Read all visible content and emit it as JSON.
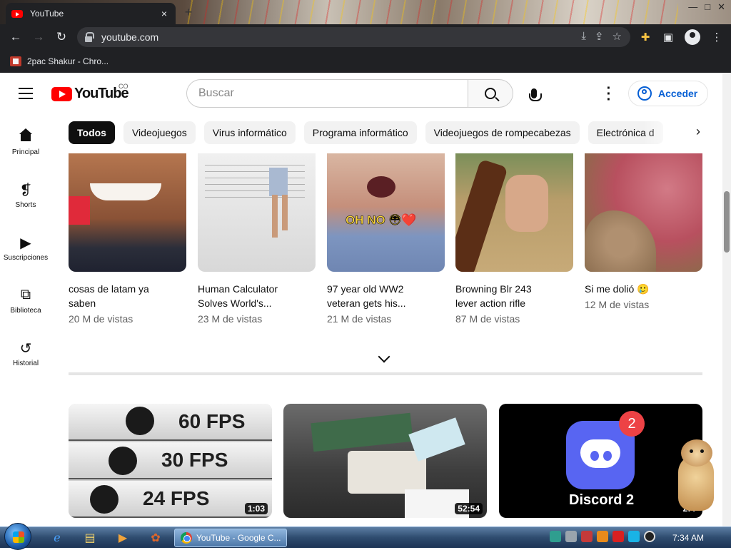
{
  "browser": {
    "tab_title": "YouTube",
    "tab_close": "×",
    "new_tab": "+",
    "window_buttons": {
      "minimize": "—",
      "maximize": "□",
      "close": "✕"
    },
    "url": "youtube.com",
    "bookmark_label": "2pac Shakur - Chro..."
  },
  "masthead": {
    "logo_text": "YouTube",
    "country_code": "CO",
    "search_placeholder": "Buscar",
    "signin_label": "Acceder"
  },
  "sidenav": [
    {
      "label": "Principal",
      "icon": "home-icon"
    },
    {
      "label": "Shorts",
      "icon": "shorts-icon"
    },
    {
      "label": "Suscripciones",
      "icon": "subscriptions-icon"
    },
    {
      "label": "Biblioteca",
      "icon": "library-icon"
    },
    {
      "label": "Historial",
      "icon": "history-icon"
    }
  ],
  "chips": [
    "Todos",
    "Videojuegos",
    "Virus informático",
    "Programa informático",
    "Videojuegos de rompecabezas",
    "Electrónica d"
  ],
  "shorts": [
    {
      "title_line1": "cosas de latam ya",
      "title_line2": "saben",
      "views": "20 M de vistas"
    },
    {
      "title_line1": "Human Calculator",
      "title_line2": "Solves World's...",
      "views": "23 M de vistas"
    },
    {
      "title_line1": "97 year old WW2",
      "title_line2": "veteran gets his...",
      "views": "21 M de vistas",
      "overlay": "OH NO 😳❤️"
    },
    {
      "title_line1": "Browning Blr 243",
      "title_line2": "lever action rifle",
      "views": "87 M de vistas"
    },
    {
      "title_line1": "Si me dolió 🥲",
      "title_line2": "",
      "views": "12 M de vistas"
    }
  ],
  "videos": [
    {
      "duration": "1:03",
      "fps_labels": [
        "60 FPS",
        "30 FPS",
        "24 FPS"
      ]
    },
    {
      "duration": "52:54"
    },
    {
      "duration": "2:4",
      "label": "Discord 2",
      "badge": "2"
    }
  ],
  "taskbar": {
    "chrome_task": "YouTube - Google C...",
    "clock": "7:34 AM"
  },
  "colors": {
    "youtube_red": "#ff0000",
    "link_blue": "#065fd4",
    "chrome_dark": "#202124",
    "discord": "#5865f2"
  }
}
